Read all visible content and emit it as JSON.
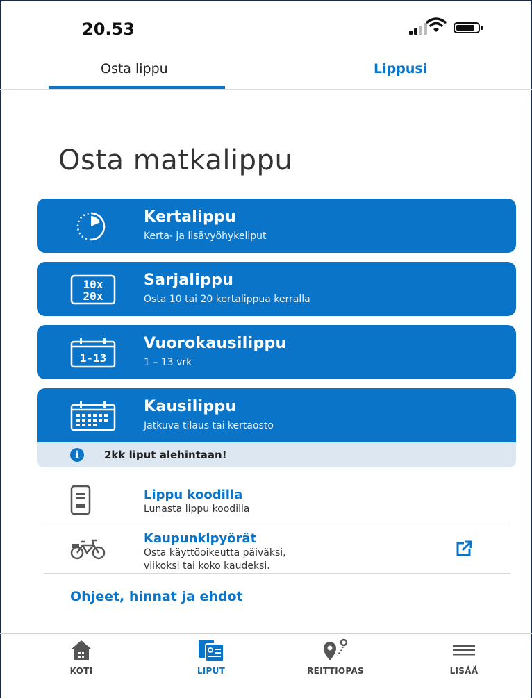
{
  "status": {
    "time": "20.53"
  },
  "tabs": {
    "buy": "Osta lippu",
    "yours": "Lippusi"
  },
  "page_title": "Osta matkalippu",
  "tickets": [
    {
      "title": "Kertalippu",
      "subtitle": "Kerta- ja lisävyöhykeliput",
      "icon": "stopwatch-icon"
    },
    {
      "title": "Sarjalippu",
      "subtitle": "Osta 10 tai 20 kertalippua kerralla",
      "icon": "series-ticket-icon",
      "icon_text": [
        "10x",
        "20x"
      ]
    },
    {
      "title": "Vuorokausilippu",
      "subtitle": "1 – 13 vrk",
      "icon": "calendar-day-icon",
      "icon_text": "1-13"
    },
    {
      "title": "Kausilippu",
      "subtitle": "Jatkuva tilaus tai kertaosto",
      "icon": "calendar-month-icon"
    }
  ],
  "promo": {
    "text": "2kk liput alehintaan!",
    "icon_glyph": "i"
  },
  "links": [
    {
      "title": "Lippu koodilla",
      "subtitle": "Lunasta lippu koodilla",
      "icon": "phone-code-icon"
    },
    {
      "title": "Kaupunkipyörät",
      "subtitle_lines": [
        "Osta käyttöoikeutta päiväksi,",
        "viikoksi tai koko kaudeksi."
      ],
      "icon": "bicycle-icon",
      "external_icon": "external-link-icon"
    }
  ],
  "help_link": "Ohjeet, hinnat ja ehdot",
  "nav": [
    {
      "label": "KOTI",
      "icon": "home-icon",
      "active": false
    },
    {
      "label": "LIPUT",
      "icon": "tickets-icon",
      "active": true
    },
    {
      "label": "REITTIOPAS",
      "icon": "route-icon",
      "active": false
    },
    {
      "label": "LISÄÄ",
      "icon": "menu-icon",
      "active": false
    }
  ],
  "colors": {
    "accent": "#0a74c9",
    "promo_bg": "#dde7f1",
    "text": "#2b2b2b"
  }
}
